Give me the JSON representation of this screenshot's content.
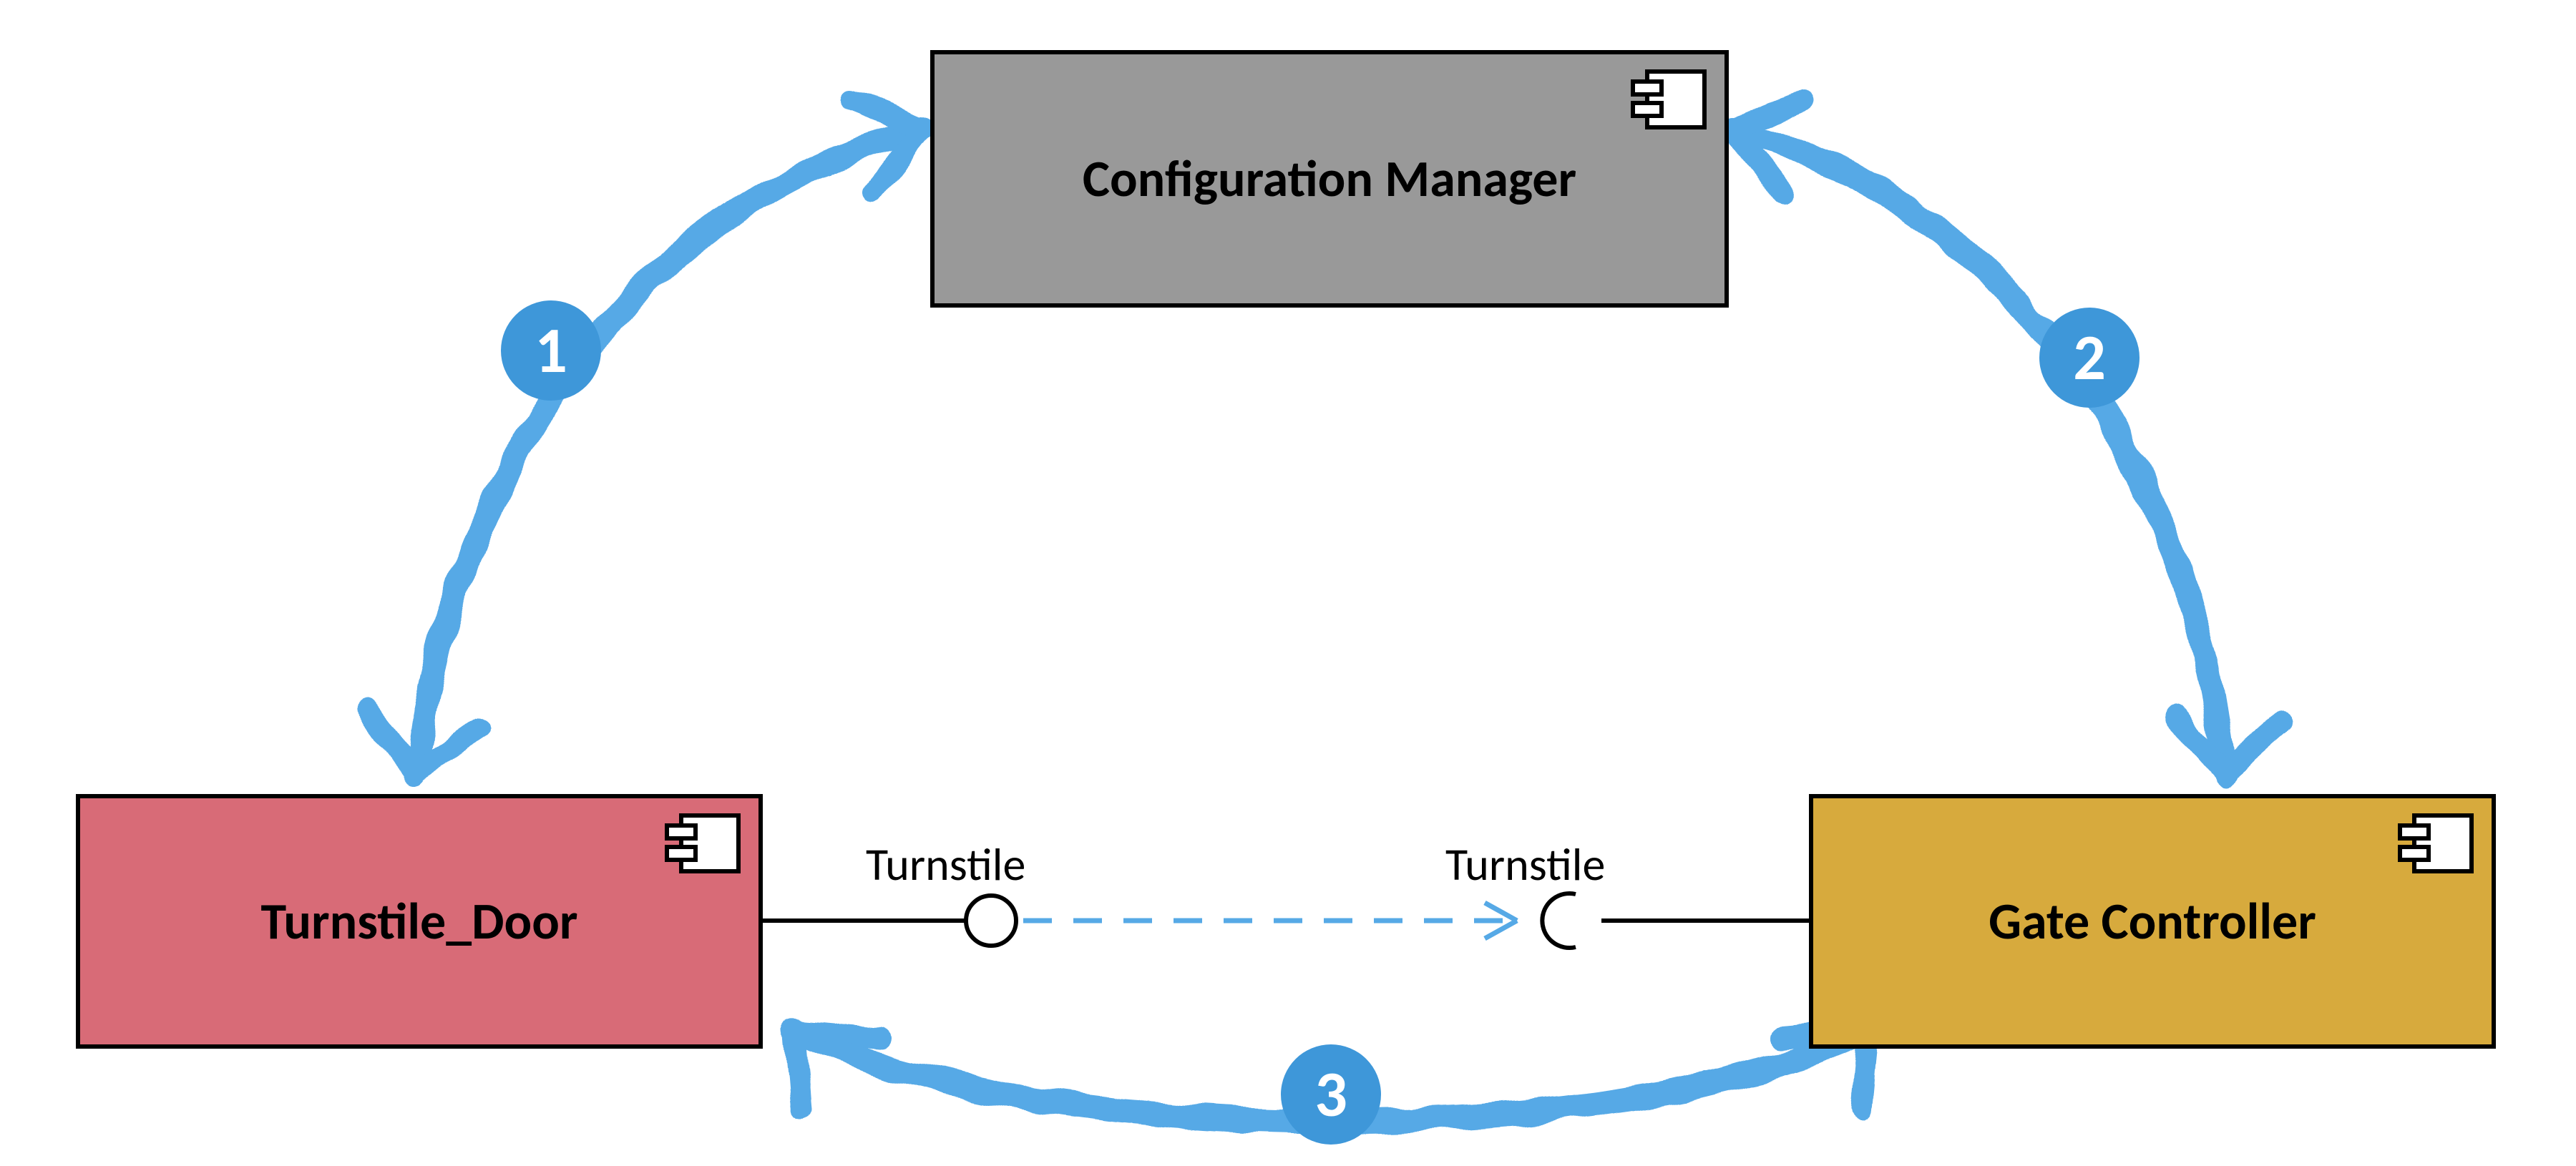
{
  "components": {
    "config_manager": {
      "label": "Configuration Manager"
    },
    "turnstile_door": {
      "label": "Turnstile_Door"
    },
    "gate_controller": {
      "label": "Gate Controller"
    }
  },
  "connectors": {
    "arc1": {
      "number": "1"
    },
    "arc2": {
      "number": "2"
    },
    "arc3": {
      "number": "3"
    }
  },
  "interfaces": {
    "provided": {
      "label": "Turnstile"
    },
    "required": {
      "label": "Turnstile"
    }
  },
  "colors": {
    "gray": "#999999",
    "red": "#d86b77",
    "gold": "#d7aa3d",
    "blue": "#3e97d9",
    "lightblue": "#56a9e6"
  }
}
